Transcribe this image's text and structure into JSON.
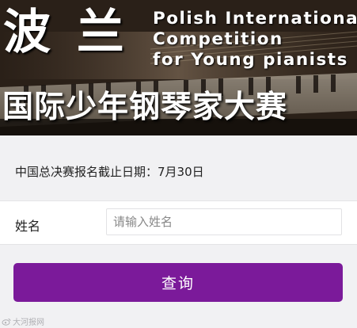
{
  "banner": {
    "title_zh_big": "波 兰",
    "title_en_lines": [
      "Polish International",
      "Competition",
      "for Young pianists"
    ],
    "title_zh_sub": "国际少年钢琴家大赛"
  },
  "info": {
    "deadline": "中国总决赛报名截止日期：7月30日"
  },
  "form": {
    "name_label": "姓名",
    "name_placeholder": "请输入姓名"
  },
  "actions": {
    "query_label": "查询"
  },
  "watermark": {
    "text": "大河报网"
  },
  "colors": {
    "button_bg": "#7b1a9a",
    "page_bg": "#f1f1f3"
  }
}
